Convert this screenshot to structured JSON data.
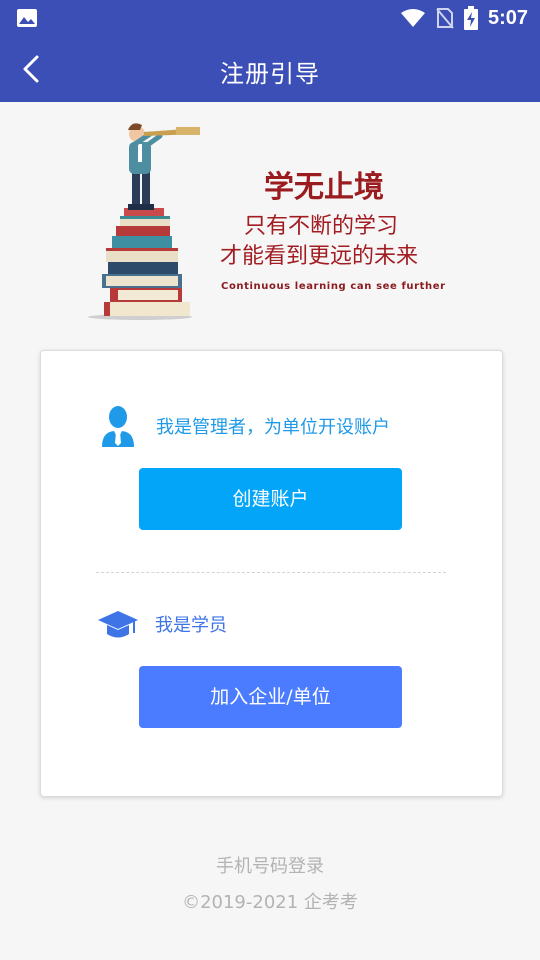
{
  "status_bar": {
    "time": "5:07"
  },
  "app_bar": {
    "title": "注册引导"
  },
  "banner": {
    "slogan_title": "学无止境",
    "slogan_line1": "只有不断的学习",
    "slogan_line2": "才能看到更远的未来",
    "slogan_en": "Continuous learning can see further"
  },
  "card": {
    "admin_text": "我是管理者，为单位开设账户",
    "create_button": "创建账户",
    "student_text": "我是学员",
    "join_button": "加入企业/单位"
  },
  "footer": {
    "phone_login": "手机号码登录",
    "copyright": "©2019-2021 企考考"
  },
  "colors": {
    "primary": "#3c4fb7",
    "create_button": "#02a5f8",
    "join_button": "#4b7cff",
    "slogan": "#a11d22"
  }
}
